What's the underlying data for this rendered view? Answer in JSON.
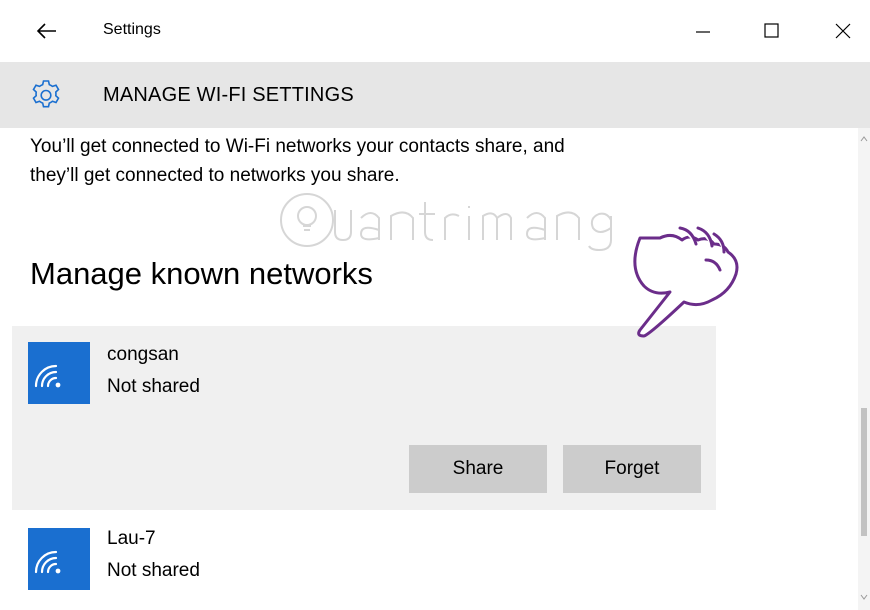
{
  "window": {
    "title": "Settings",
    "controls": {
      "minimize": "minimize-icon",
      "maximize": "maximize-icon",
      "close": "close-icon"
    }
  },
  "header": {
    "title": "MANAGE WI-FI SETTINGS",
    "icon": "gear-icon"
  },
  "main": {
    "description_line1": "You’ll get connected to Wi-Fi networks your contacts share, and",
    "description_line2": "they’ll get connected to networks you share.",
    "section_title": "Manage known networks",
    "networks": [
      {
        "name": "congsan",
        "status": "Not shared",
        "icon": "wifi-icon",
        "expanded": true,
        "actions": {
          "share": "Share",
          "forget": "Forget"
        }
      },
      {
        "name": "Lau-7",
        "status": "Not shared",
        "icon": "wifi-icon",
        "expanded": false
      }
    ]
  },
  "colors": {
    "accent": "#1a6fd0",
    "header_bg": "#e6e6e6",
    "selected_bg": "#f0f0f0",
    "button_bg": "#cccccc",
    "pointer_hand": "#6b2d8a"
  }
}
